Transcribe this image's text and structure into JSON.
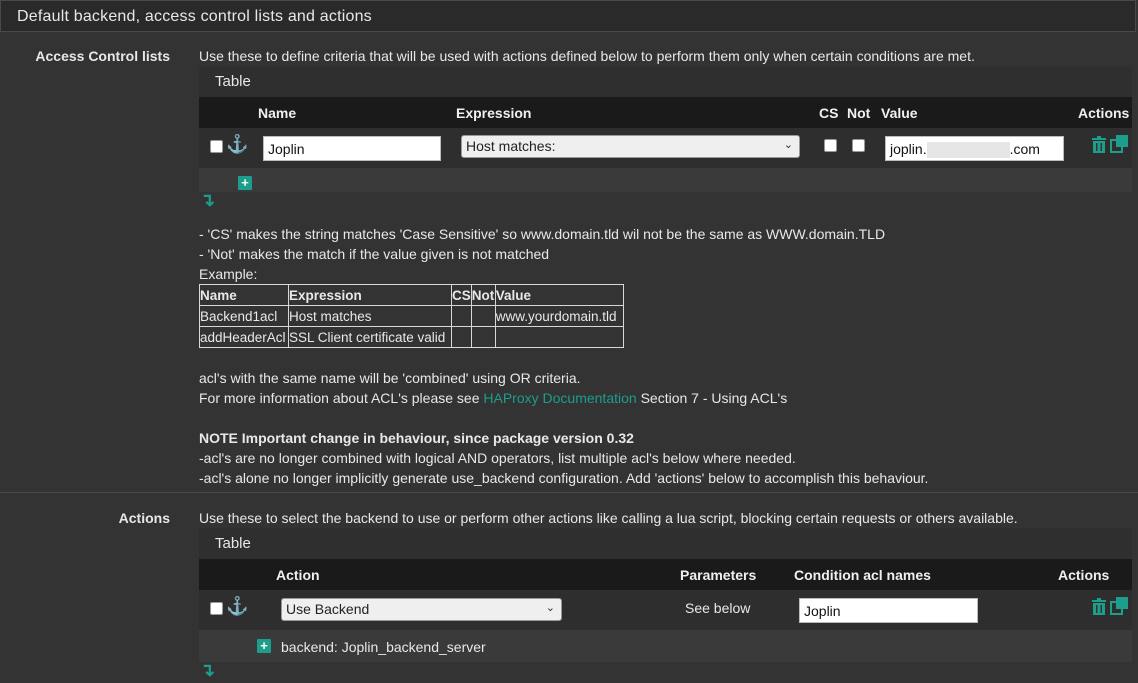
{
  "section": {
    "title": "Default backend, access control lists and actions"
  },
  "acl": {
    "label": "Access Control lists",
    "description": "Use these to define criteria that will be used with actions defined below to perform them only when certain conditions are met.",
    "table_label": "Table",
    "columns": {
      "name": "Name",
      "expression": "Expression",
      "cs": "CS",
      "not": "Not",
      "value": "Value",
      "actions": "Actions"
    },
    "row": {
      "name": "Joplin",
      "expression": "Host matches:",
      "value_prefix": "joplin.",
      "value_suffix": ".com"
    }
  },
  "help": {
    "cs_note": "- 'CS' makes the string matches 'Case Sensitive' so www.domain.tld wil not be the same as WWW.domain.TLD",
    "not_note": "- 'Not' makes the match if the value given is not matched",
    "example_label": "Example:",
    "example_headers": [
      "Name",
      "Expression",
      "CS",
      "Not",
      "Value"
    ],
    "example_rows": [
      [
        "Backend1acl",
        "Host matches",
        "",
        "",
        "www.yourdomain.tld"
      ],
      [
        "addHeaderAcl",
        "SSL Client certificate valid",
        "",
        "",
        ""
      ]
    ],
    "combined_note": "acl's with the same name will be 'combined' using OR criteria.",
    "more_info_prefix": "For more information about ACL's please see",
    "more_info_link": "HAProxy Documentation",
    "more_info_suffix": "Section 7 - Using ACL's",
    "note_title": "NOTE Important change in behaviour, since package version 0.32",
    "note_line1": "-acl's are no longer combined with logical AND operators, list multiple acl's below where needed.",
    "note_line2": "-acl's alone no longer implicitly generate use_backend configuration. Add 'actions' below to accomplish this behaviour."
  },
  "actions": {
    "label": "Actions",
    "description": "Use these to select the backend to use or perform other actions like calling a lua script, blocking certain requests or others available.",
    "table_label": "Table",
    "columns": {
      "action": "Action",
      "parameters": "Parameters",
      "condition": "Condition acl names",
      "actions": "Actions"
    },
    "row": {
      "action": "Use Backend",
      "parameters": "See below",
      "condition": "Joplin"
    },
    "detail": "backend: Joplin_backend_server"
  },
  "colors": {
    "accent": "#1d9d8c",
    "background": "#333333",
    "table_header": "#1a1a1a"
  },
  "icons": [
    "anchor-icon",
    "trash-icon",
    "copy-icon",
    "plus-icon",
    "arrow-down-icon",
    "chevron-down-icon"
  ]
}
